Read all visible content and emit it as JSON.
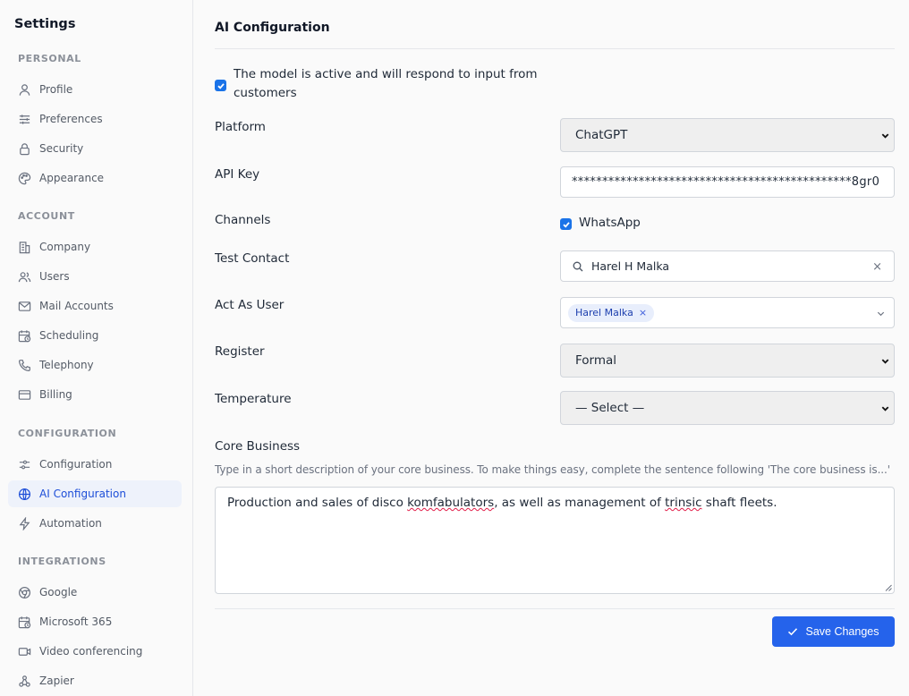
{
  "sidebar": {
    "title": "Settings",
    "sections": [
      {
        "label": "PERSONAL",
        "items": [
          "Profile",
          "Preferences",
          "Security",
          "Appearance"
        ]
      },
      {
        "label": "ACCOUNT",
        "items": [
          "Company",
          "Users",
          "Mail Accounts",
          "Scheduling",
          "Telephony",
          "Billing"
        ]
      },
      {
        "label": "CONFIGURATION",
        "items": [
          "Configuration",
          "AI Configuration",
          "Automation"
        ]
      },
      {
        "label": "INTEGRATIONS",
        "items": [
          "Google",
          "Microsoft 365",
          "Video conferencing",
          "Zapier"
        ]
      }
    ],
    "active_item": "AI Configuration"
  },
  "main": {
    "title": "AI Configuration",
    "active_checkbox_label": "The model is active and will respond to input from customers",
    "active_checked": true,
    "platform": {
      "label": "Platform",
      "value": "ChatGPT"
    },
    "api_key": {
      "label": "API Key",
      "value": "**********************************************8gr0"
    },
    "channels": {
      "label": "Channels",
      "option": "WhatsApp",
      "checked": true
    },
    "test_contact": {
      "label": "Test Contact",
      "value": "Harel H Malka",
      "clear": "×"
    },
    "act_as_user": {
      "label": "Act As User",
      "tag": "Harel Malka",
      "tag_remove": "×"
    },
    "register": {
      "label": "Register",
      "value": "Formal"
    },
    "temperature": {
      "label": "Temperature",
      "value": "— Select —"
    },
    "core_business": {
      "label": "Core Business",
      "help": "Type in a short description of your core business. To make things easy, complete the sentence following 'The core business is...'",
      "text_parts": [
        "Production and sales of disco ",
        "komfabulators",
        ", as well as management of ",
        "trinsic",
        " shaft fleets."
      ]
    },
    "save_label": "Save Changes"
  },
  "colors": {
    "accent": "#2563eb",
    "active_bg": "#eef2fb",
    "active_text": "#1d4ed8"
  }
}
